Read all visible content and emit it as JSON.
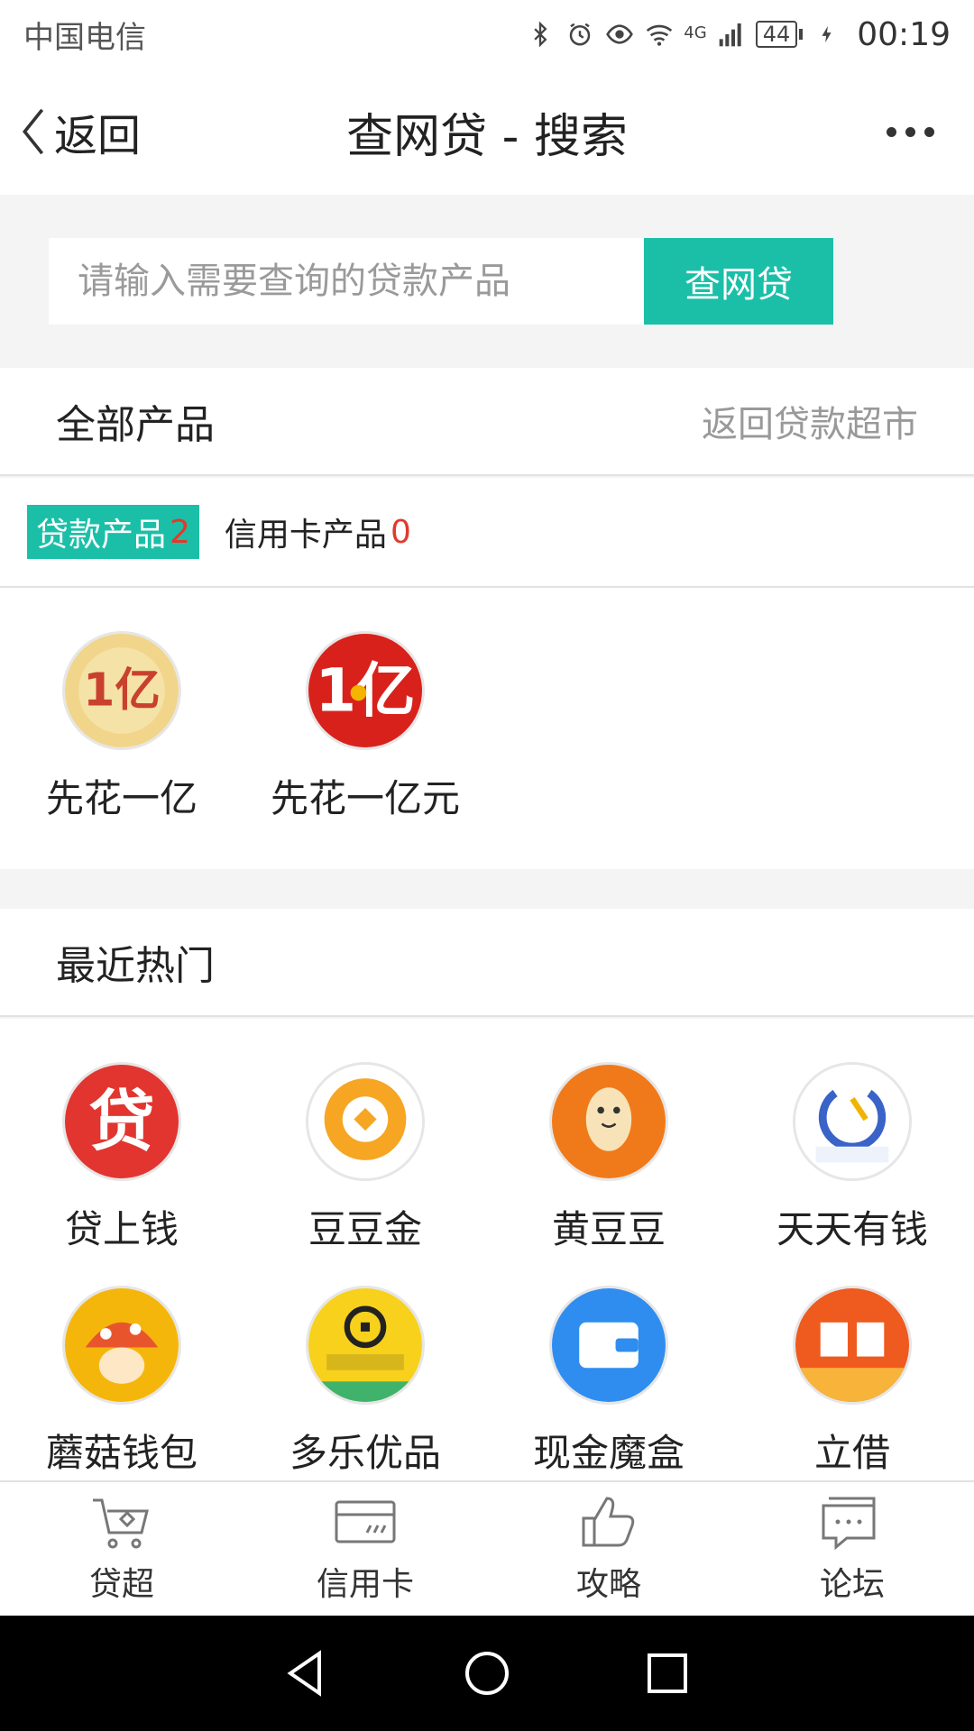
{
  "status_bar": {
    "carrier": "中国电信",
    "network": "4G",
    "battery": "44",
    "time": "00:19"
  },
  "nav": {
    "back_label": "返回",
    "title": "查网贷 - 搜索",
    "more_icon": "more-dots-icon"
  },
  "search": {
    "placeholder": "请输入需要查询的贷款产品",
    "value": "",
    "button_label": "查网贷"
  },
  "all_products": {
    "title": "全部产品",
    "link_label": "返回贷款超市"
  },
  "tabs": [
    {
      "label": "贷款产品",
      "count": "2"
    },
    {
      "label": "信用卡产品",
      "count": "0"
    }
  ],
  "products": [
    {
      "name": "先花一亿"
    },
    {
      "name": "先花一亿元"
    }
  ],
  "hot": {
    "title": "最近热门",
    "items": [
      {
        "name": "贷上钱"
      },
      {
        "name": "豆豆金"
      },
      {
        "name": "黄豆豆"
      },
      {
        "name": "天天有钱"
      },
      {
        "name": "蘑菇钱包"
      },
      {
        "name": "多乐优品"
      },
      {
        "name": "现金魔盒"
      },
      {
        "name": "立借"
      }
    ]
  },
  "bottom_tabs": [
    {
      "label": "贷超",
      "icon": "cart-icon"
    },
    {
      "label": "信用卡",
      "icon": "credit-card-icon"
    },
    {
      "label": "攻略",
      "icon": "thumbs-up-icon"
    },
    {
      "label": "论坛",
      "icon": "chat-icon"
    }
  ],
  "colors": {
    "accent": "#1bbfa8",
    "count_red": "#e03a2d",
    "muted": "#999999"
  }
}
